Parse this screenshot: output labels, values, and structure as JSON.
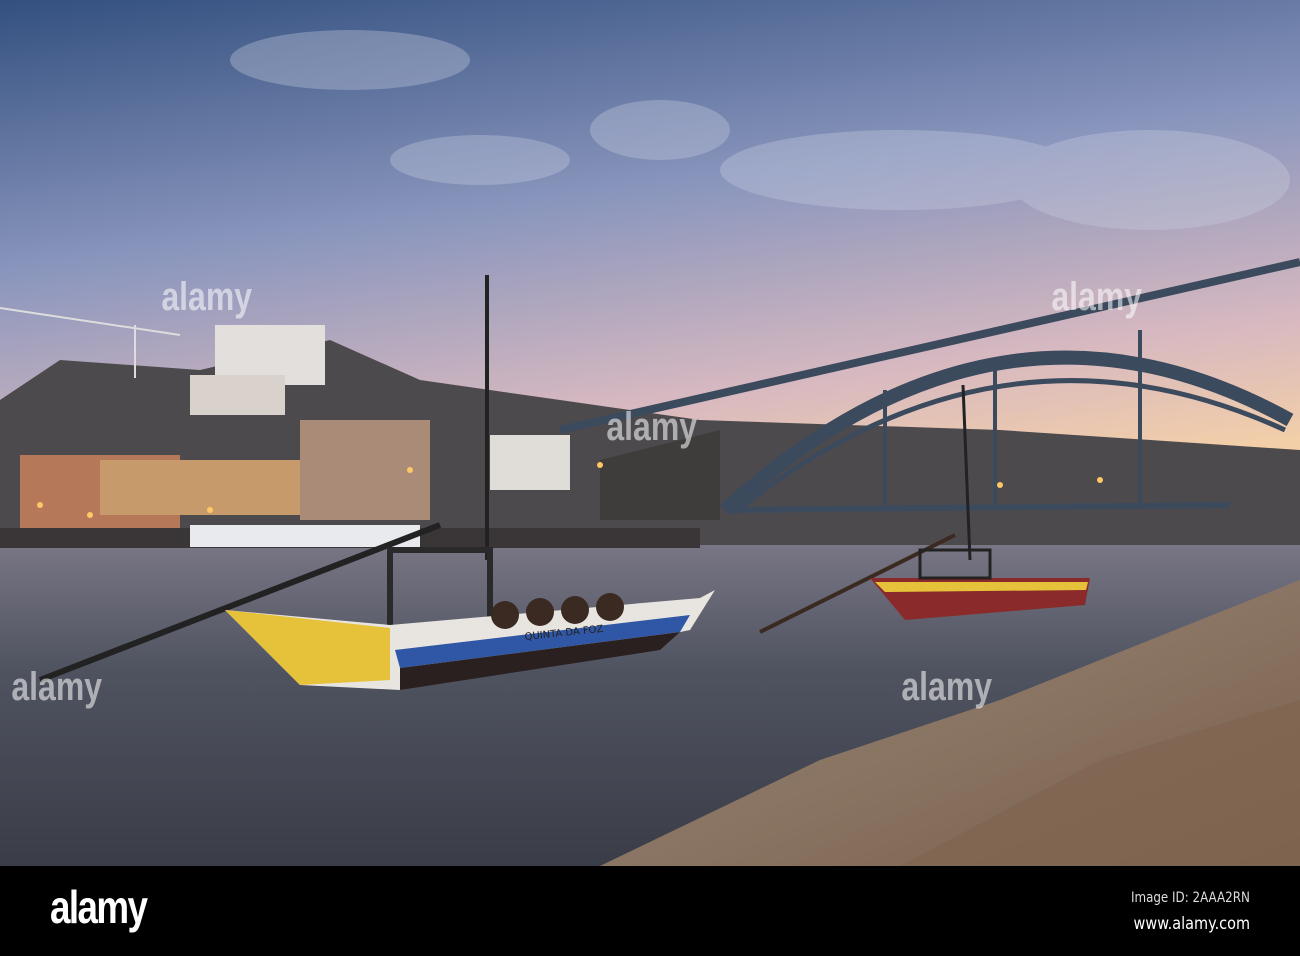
{
  "photo": {
    "subject": "porto-river-boats-bridge",
    "boat_name": "QUINTA DA FOZ",
    "colors": {
      "sky_top": "#3f5a85",
      "sky_mid": "#9aa6c8",
      "sky_horizon": "#f0c7a8",
      "water": "#5a5e6a",
      "rocks": "#8a7563"
    }
  },
  "watermark": {
    "text": "alamy"
  },
  "footer": {
    "logo": "alamy",
    "image_id": "Image ID: 2AAA2RN",
    "url": "www.alamy.com"
  }
}
